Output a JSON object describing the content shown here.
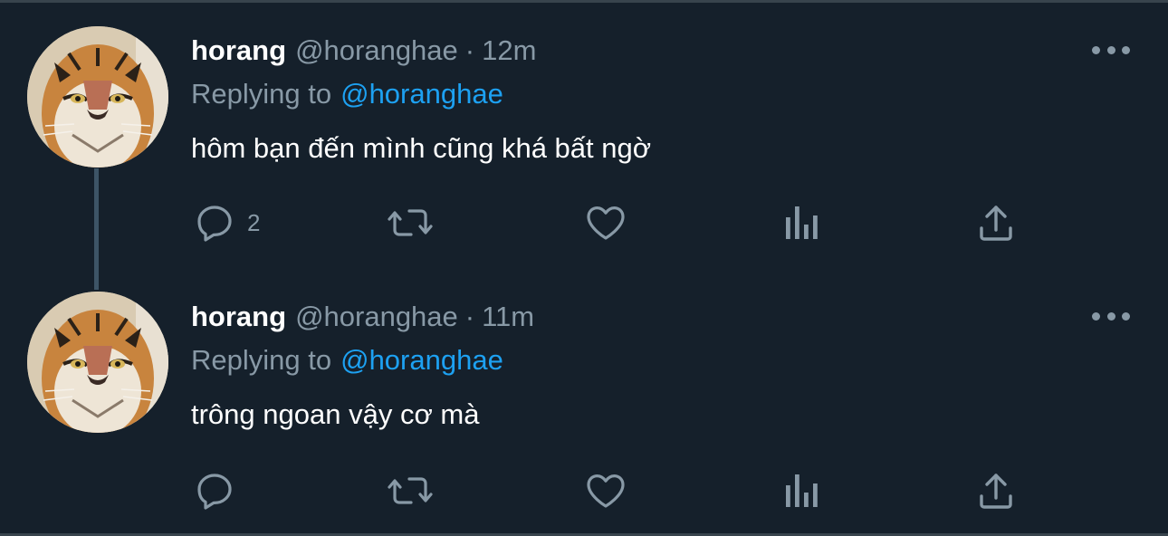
{
  "tweets": [
    {
      "name": "horang",
      "handle": "@horanghae",
      "separator": "·",
      "time": "12m",
      "replying_label": "Replying to",
      "replying_to": "@horanghae",
      "text": "hôm bạn đến mình cũng khá bất ngờ",
      "reply_count": "2",
      "avatar": "tiger-face-avatar"
    },
    {
      "name": "horang",
      "handle": "@horanghae",
      "separator": "·",
      "time": "11m",
      "replying_label": "Replying to",
      "replying_to": "@horanghae",
      "text": "trông ngoan vậy cơ mà",
      "reply_count": "",
      "avatar": "tiger-face-avatar"
    }
  ],
  "icons": {
    "reply": "reply-icon",
    "retweet": "retweet-icon",
    "like": "heart-icon",
    "analytics": "analytics-icon",
    "share": "share-icon",
    "more": "more-icon"
  },
  "colors": {
    "background": "#15202b",
    "secondary_text": "#8899a6",
    "accent": "#1da1f2",
    "thread_line": "#3d5466"
  }
}
